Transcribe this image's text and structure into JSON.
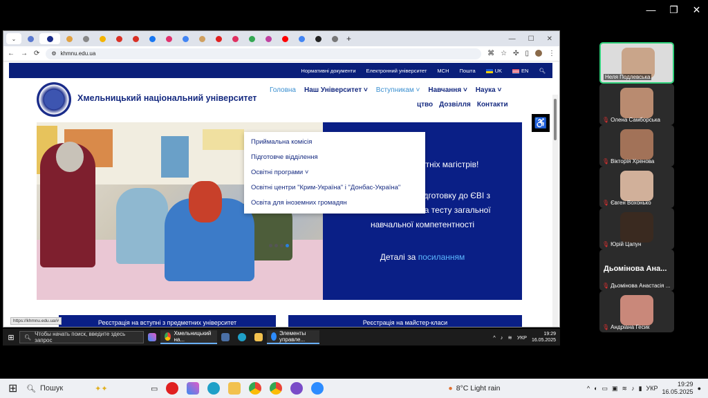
{
  "url": "khmnu.edu.ua",
  "status_url": "https://khmnu.edu.ua/#",
  "site": {
    "brand": "Хмельницький національний університет",
    "topnav": [
      "Нормативні документи",
      "Електронний університет",
      "МСН",
      "Пошта",
      "UK",
      "EN"
    ],
    "menu": {
      "home": "Головна",
      "university": "Наш Університет ˅",
      "admission": "Вступникам ˅",
      "study": "Навчання ˅",
      "science": "Наука ˅",
      "row2_a": "цтво",
      "row2_b": "Дозвілля",
      "row2_c": "Контакти"
    },
    "dropdown": [
      "Приймальна комісія",
      "Підготовче відділення",
      "Освітні програми ˅",
      "Освітні центри \"Крим-Україна\" і \"Донбас-Україна\"",
      "Освіта для іноземних громадян"
    ],
    "hero": {
      "heading": "айбутніх магістрів!",
      "body": "Запрошуємо на підготовку до ЄВІ з англійської мови та тесту загальної навчальної компетентності",
      "link_prefix": "Деталі за",
      "link": "посиланням"
    },
    "card_left": "Реєстрація на вступні з предметних університет",
    "card_right": "Реєстрація на майстер-класи"
  },
  "inner_taskbar": {
    "search": "Чтобы начать поиск, введите здесь запрос",
    "app1": "Хмельницький на...",
    "app2": "Элементы управле...",
    "lang": "УКР",
    "time": "19:29",
    "date": "16.05.2025"
  },
  "participants": [
    {
      "name": "Неля Подлевська",
      "color": "#c9a58a"
    },
    {
      "name": "Олена Самборська",
      "color": "#b98b70"
    },
    {
      "name": "Вікторія Хренова",
      "color": "#a27258"
    },
    {
      "name": "Євген Вохонько",
      "color": "#d1b09a"
    },
    {
      "name": "Юрій Цапун",
      "color": "#3a2a20"
    },
    {
      "name": "Дьомінова Анастасія ...",
      "big": "Дьомінова Ана..."
    },
    {
      "name": "Андріана Гесик",
      "color": "#c9887a"
    }
  ],
  "outer_taskbar": {
    "search": "Пошук",
    "weather": "8°C  Light rain",
    "lang": "УКР",
    "time": "19:29",
    "date": "16.05.2025"
  }
}
